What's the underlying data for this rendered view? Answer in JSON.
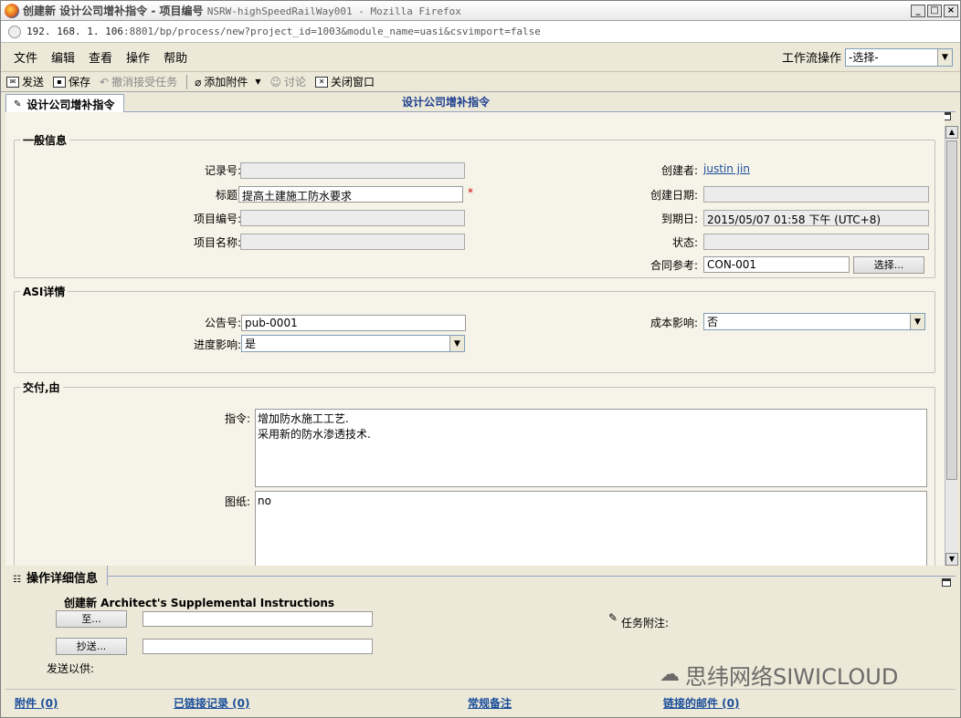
{
  "window": {
    "title_prefix": "创建新 设计公司增补指令 - 项目编号 ",
    "title_code": "NSRW-highSpeedRailWay001 - Mozilla Firefox",
    "url_host": "192. 168. 1. 106",
    "url_rest": ":8801/bp/process/new?project_id=1003&module_name=uasi&csvimport=false"
  },
  "menu": [
    "文件",
    "编辑",
    "查看",
    "操作",
    "帮助"
  ],
  "workflow": {
    "label": "工作流操作",
    "value": "-选择-"
  },
  "toolbar": {
    "send": "发送",
    "save": "保存",
    "cancel_accept": "撤消接受任务",
    "add_attachment": "添加附件",
    "discuss": "讨论",
    "close": "关闭窗口"
  },
  "tab": {
    "label": "设计公司增补指令"
  },
  "form_title": "设计公司增补指令",
  "general": {
    "legend": "一般信息",
    "record_no_label": "记录号:",
    "record_no": "",
    "title_label": "标题:",
    "title": "提高土建施工防水要求",
    "project_no_label": "项目编号:",
    "project_no": "",
    "project_name_label": "项目名称:",
    "project_name": "",
    "creator_label": "创建者:",
    "creator": "justin jin",
    "created_date_label": "创建日期:",
    "created_date": "",
    "due_date_label": "到期日:",
    "due_date": "2015/05/07 01:58 下午 (UTC+8)",
    "status_label": "状态:",
    "status": "",
    "contract_label": "合同参考:",
    "contract": "CON-001",
    "select_btn": "选择..."
  },
  "asi": {
    "legend": "ASI详情",
    "bulletin_label": "公告号:",
    "bulletin": "pub-0001",
    "schedule_label": "进度影响:",
    "schedule": "是",
    "cost_label": "成本影响:",
    "cost": "否"
  },
  "deliver": {
    "legend": "交付,由",
    "instruction_label": "指令:",
    "instruction": "增加防水施工工艺.\n采用新的防水渗透技术.",
    "drawing_label": "图纸:",
    "drawing": "no"
  },
  "detail": {
    "tab": "操作详细信息",
    "heading": "创建新 Architect's Supplemental Instructions",
    "to_btn": "至...",
    "cc_btn": "抄送...",
    "for_label": "发送以供:",
    "task_note": "任务附注:"
  },
  "footer": {
    "attachments": "附件 (0)",
    "linked_records": "已链接记录 (0)",
    "general_notes": "常规备注",
    "linked_mail": "链接的邮件 (0)"
  },
  "watermark": "思纬网络SIWICLOUD"
}
